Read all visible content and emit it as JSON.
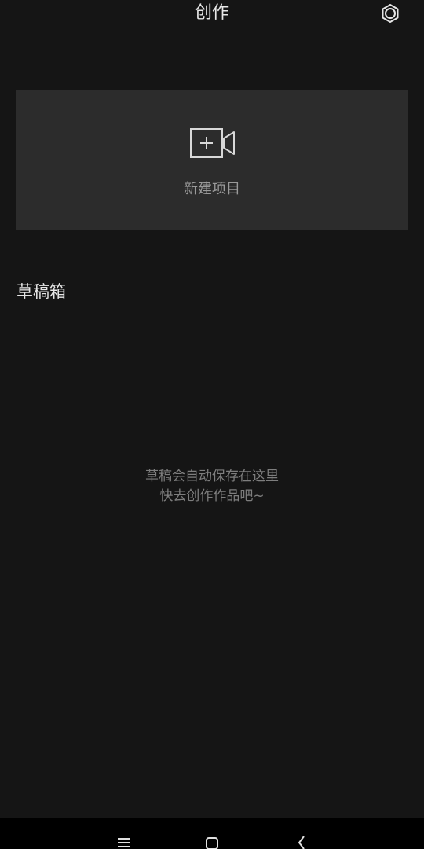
{
  "header": {
    "title": "创作",
    "settings_icon": "settings-gear-icon"
  },
  "new_project": {
    "label": "新建项目",
    "icon": "video-camera-plus-icon"
  },
  "drafts": {
    "title": "草稿箱",
    "empty_line1": "草稿会自动保存在这里",
    "empty_line2": "快去创作作品吧~"
  },
  "navbar": {
    "menu_icon": "menu-icon",
    "home_icon": "home-icon",
    "back_icon": "back-icon"
  },
  "colors": {
    "background": "#151515",
    "card": "#2c2c2c",
    "navbar": "#000000"
  }
}
